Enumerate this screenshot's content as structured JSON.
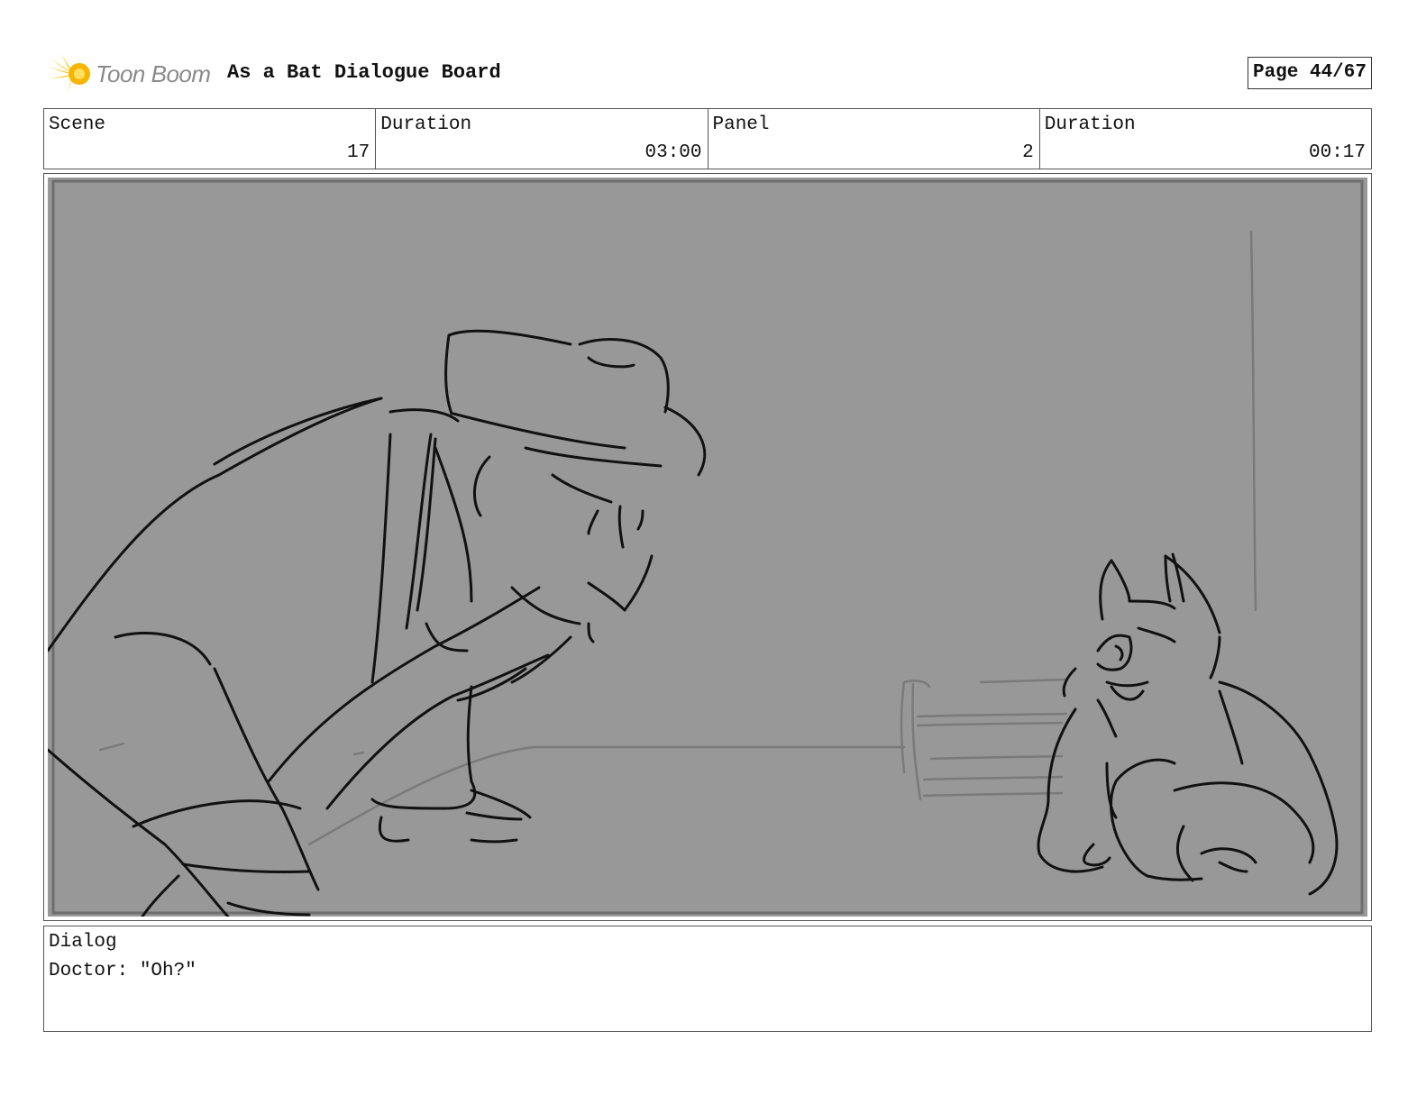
{
  "header": {
    "logo_text": "Toon Boom",
    "board_title": "As a Bat Dialogue Board",
    "page_label": "Page 44/67"
  },
  "info": {
    "scene_label": "Scene",
    "scene_value": "17",
    "scene_duration_label": "Duration",
    "scene_duration_value": "03:00",
    "panel_label": "Panel",
    "panel_value": "2",
    "panel_duration_label": "Duration",
    "panel_duration_value": "00:17"
  },
  "dialog": {
    "label": "Dialog",
    "text": "Doctor: \"Oh?\""
  },
  "colors": {
    "logo_accent": "#f5c400",
    "panel_background": "#989898",
    "sketch_ink": "#111111",
    "sketch_light": "#7a7a7a"
  }
}
